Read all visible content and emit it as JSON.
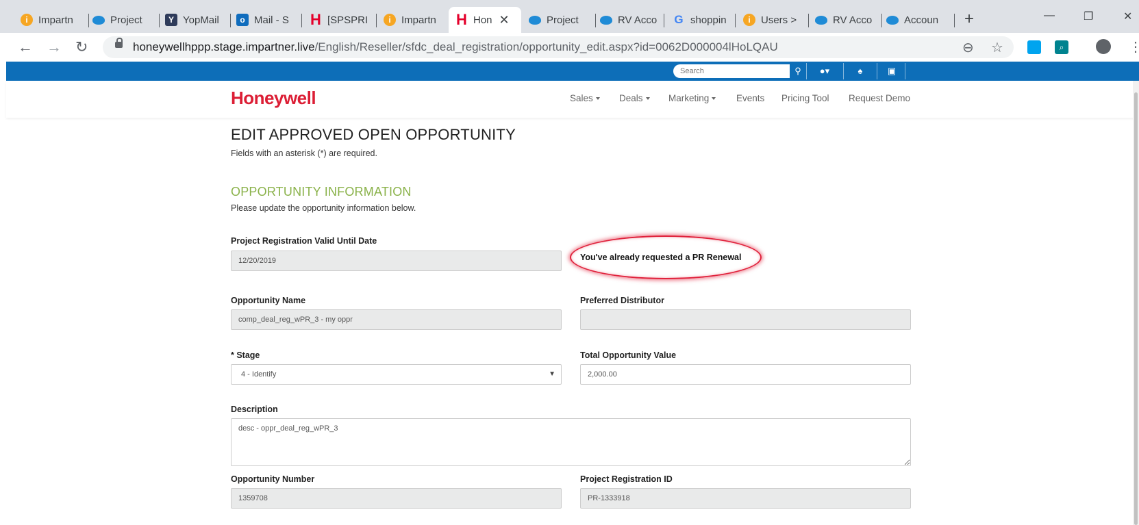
{
  "browser": {
    "tabs": [
      {
        "title": "Impartn",
        "favicon": "impartner-icon",
        "active": false
      },
      {
        "title": "Project",
        "favicon": "salesforce-icon",
        "active": false
      },
      {
        "title": "YopMail",
        "favicon": "yopmail-icon",
        "active": false
      },
      {
        "title": "Mail - S",
        "favicon": "outlook-icon",
        "active": false
      },
      {
        "title": "[SPSPRI",
        "favicon": "honeywell-icon",
        "active": false
      },
      {
        "title": "Impartn",
        "favicon": "impartner-icon",
        "active": false
      },
      {
        "title": "Hon",
        "favicon": "honeywell-icon",
        "active": true
      },
      {
        "title": "Project",
        "favicon": "salesforce-icon",
        "active": false
      },
      {
        "title": "RV Acco",
        "favicon": "salesforce-icon",
        "active": false
      },
      {
        "title": "shoppin",
        "favicon": "google-icon",
        "active": false
      },
      {
        "title": "Users >",
        "favicon": "impartner-icon",
        "active": false
      },
      {
        "title": "RV Acco",
        "favicon": "salesforce-icon",
        "active": false
      },
      {
        "title": "Accoun",
        "favicon": "salesforce-icon",
        "active": false
      }
    ],
    "url_host": "honeywellhppp.stage.impartner.live",
    "url_path": "/English/Reseller/sfdc_deal_registration/opportunity_edit.aspx?id=0062D000004lHoLQAU"
  },
  "site": {
    "search_placeholder": "Search",
    "logo_text": "Honeywell",
    "nav": {
      "sales": "Sales",
      "deals": "Deals",
      "marketing": "Marketing",
      "events": "Events",
      "pricing_tool": "Pricing Tool",
      "request_demo": "Request Demo"
    },
    "brand_color": "#0d6eb8",
    "accent_color": "#8ab24a"
  },
  "form": {
    "title": "EDIT APPROVED OPEN OPPORTUNITY",
    "required_note": "Fields with an asterisk (*) are required.",
    "section_title": "OPPORTUNITY INFORMATION",
    "section_note": "Please update the opportunity information below.",
    "pr_valid_label": "Project Registration Valid Until Date",
    "pr_valid_value": "12/20/2019",
    "renewal_message": "You've already requested a PR Renewal",
    "opp_name_label": "Opportunity Name",
    "opp_name_value": "comp_deal_reg_wPR_3 - my oppr",
    "pref_dist_label": "Preferred Distributor",
    "pref_dist_value": "",
    "stage_label": "* Stage",
    "stage_value": "4 - Identify",
    "total_value_label": "Total Opportunity Value",
    "total_value_value": "2,000.00",
    "description_label": "Description",
    "description_value": "desc - oppr_deal_reg_wPR_3",
    "opp_number_label": "Opportunity Number",
    "opp_number_value": "1359708",
    "pr_id_label": "Project Registration ID",
    "pr_id_value": "PR-1333918"
  }
}
